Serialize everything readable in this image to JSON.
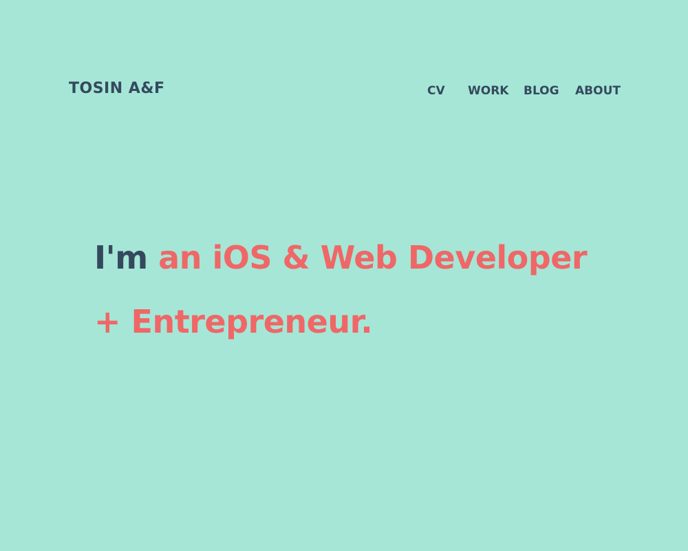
{
  "header": {
    "logo": "TOSIN A&F",
    "nav": [
      {
        "label": "CV"
      },
      {
        "label": "WORK"
      },
      {
        "label": "BLOG"
      },
      {
        "label": "ABOUT"
      }
    ]
  },
  "hero": {
    "lead": "I'm",
    "rest": "an iOS & Web Developer + Entrepreneur."
  },
  "colors": {
    "background": "#a6e6d6",
    "dark": "#34495e",
    "accent": "#ef6767"
  }
}
